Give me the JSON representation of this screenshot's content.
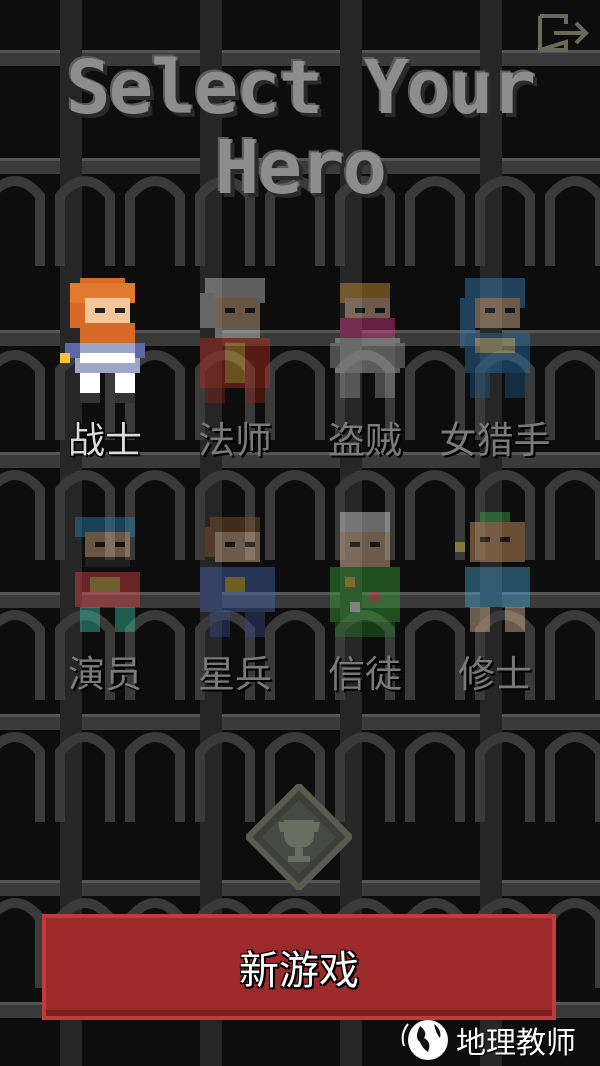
{
  "header": {
    "title": "Select Your Hero",
    "exit_icon": "exit-icon"
  },
  "heroes": [
    {
      "name": "战士",
      "locked": false
    },
    {
      "name": "法师",
      "locked": true
    },
    {
      "name": "盗贼",
      "locked": true
    },
    {
      "name": "女猎手",
      "locked": true
    },
    {
      "name": "演员",
      "locked": true
    },
    {
      "name": "星兵",
      "locked": true
    },
    {
      "name": "信徒",
      "locked": true
    },
    {
      "name": "修士",
      "locked": true
    }
  ],
  "trophy": {
    "icon": "trophy-icon"
  },
  "new_game": {
    "label": "新游戏"
  },
  "watermark": {
    "text": "地理教师"
  },
  "colors": {
    "button_red": "#9c2a2a",
    "button_border": "#c23a3a",
    "stone": "#4a4a4a",
    "title_gray": "#8d8d8d"
  }
}
